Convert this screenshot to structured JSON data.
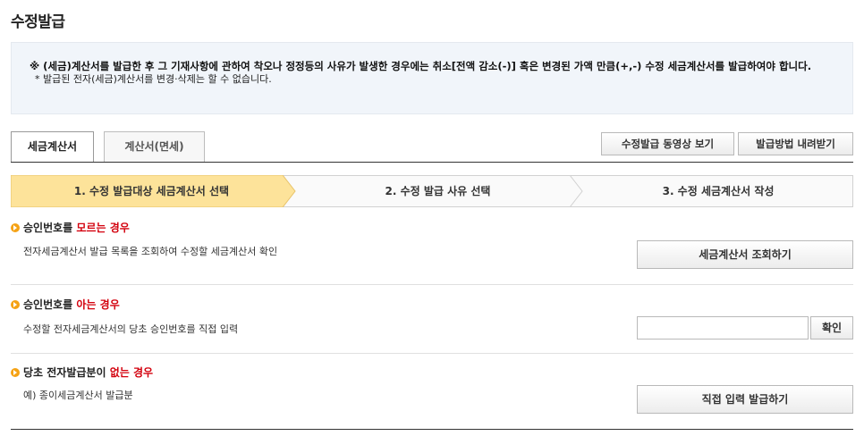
{
  "page": {
    "title": "수정발급"
  },
  "notice": {
    "main": "※ (세금)계산서를 발급한 후 그 기재사항에 관하여 착오나 정정등의 사유가 발생한 경우에는 취소[전액 감소(-)] 혹은 변경된 가액 만큼(+,-) 수정 세금계산서를 발급하여야 합니다.",
    "sub": "* 발급된 전자(세금)계산서를 변경·삭제는 할 수 없습니다."
  },
  "tabs": [
    {
      "label": "세금계산서",
      "active": true
    },
    {
      "label": "계산서(면세)",
      "active": false
    }
  ],
  "toolbar": {
    "video_label": "수정발급 동영상 보기",
    "download_label": "발급방법 내려받기"
  },
  "steps": [
    {
      "label": "1. 수정 발급대상 세금계산서 선택",
      "active": true
    },
    {
      "label": "2. 수정 발급 사유 선택",
      "active": false
    },
    {
      "label": "3. 수정 세금계산서 작성",
      "active": false
    }
  ],
  "sections": {
    "unknown": {
      "head_pre": "승인번호를 ",
      "head_hl": "모르는 경우",
      "desc": "전자세금계산서 발급 목록을 조회하여 수정할 세금계산서 확인",
      "button": "세금계산서 조회하기"
    },
    "known": {
      "head_pre": "승인번호를 ",
      "head_hl": "아는 경우",
      "desc": "수정할 전자세금계산서의 당초 승인번호를 직접 입력",
      "input_value": "",
      "button": "확인"
    },
    "none": {
      "head_pre": "당초 전자발급분이 ",
      "head_hl": "없는 경우",
      "desc": "예) 종이세금계산서 발급분",
      "button": "직접 입력 발급하기"
    }
  },
  "colors": {
    "step_active": "#fde39a",
    "highlight": "#d3000d",
    "bullet": "#f5a214",
    "notice_bg": "#f1f5fa"
  }
}
